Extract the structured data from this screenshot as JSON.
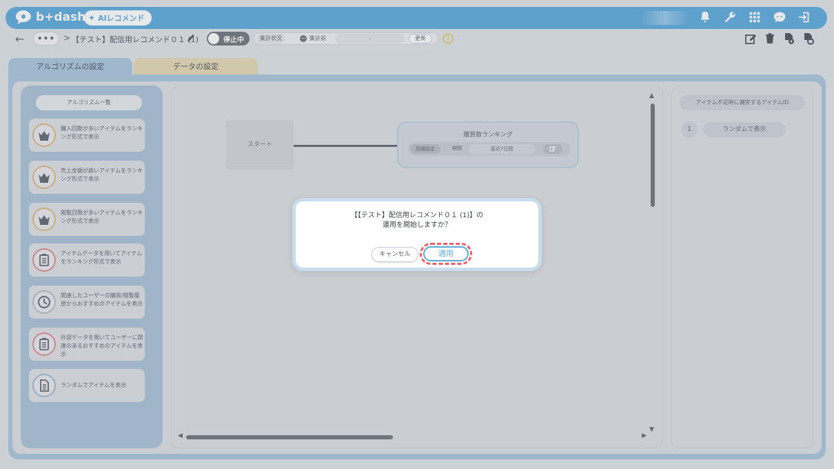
{
  "header": {
    "brand": "b+dash",
    "ai_badge": "AIレコメンド",
    "icons": [
      "bell-icon",
      "wrench-icon",
      "grid-icon",
      "chat-icon",
      "logout-icon"
    ]
  },
  "subbar": {
    "dots": "•••",
    "separator": ">",
    "title": "【テスト】配信用レコメンド０１ (1)",
    "toggle_label": "停止中",
    "status_label": "集計状況",
    "status_icon": "−",
    "status_state": "集計前",
    "status_value": "-",
    "update_label": "更新",
    "tools": [
      "edit-icon",
      "trash-icon",
      "file-gear-icon",
      "file-settings-icon"
    ]
  },
  "tabs": [
    {
      "label": "アルゴリズムの設定",
      "active": true
    },
    {
      "label": "データの設定",
      "active": false
    }
  ],
  "algorithms": {
    "header": "アルゴリズム一覧",
    "items": [
      {
        "label": "購入回数が多いアイテムをランキング形式で表示",
        "icon": "crown-icon",
        "color": "#d9b87a"
      },
      {
        "label": "売上金額が高いアイテムをランキング形式で表示",
        "icon": "crown-icon",
        "color": "#d9b87a"
      },
      {
        "label": "閲覧回数が多いアイテムをランキング形式で表示",
        "icon": "crown-icon",
        "color": "#d9b87a"
      },
      {
        "label": "アイテムデータを用いてアイテムをランキング形式で表示",
        "icon": "clipboard-icon",
        "color": "#d98a8a"
      },
      {
        "label": "関連したユーザーの購買/閲覧履歴からおすすめのアイテムを表示",
        "icon": "clock-icon",
        "color": "#b3bac0"
      },
      {
        "label": "外部データを用いてユーザーに関連のあるおすすめのアイテムを表示",
        "icon": "clipboard-icon",
        "color": "#d98a8a"
      },
      {
        "label": "ランダムでアイテムを表示",
        "icon": "document-icon",
        "color": "#9db8cf"
      }
    ]
  },
  "canvas": {
    "start_node": "スタート",
    "rank_node": {
      "title": "購買数ランキング",
      "detail_label": "詳細設定",
      "period_label": "期間",
      "period_value": "直近7日間"
    }
  },
  "fallback": {
    "header": "アイテム不足時に補完するアイテムID",
    "items": [
      {
        "num": "1",
        "label": "ランダムで表示"
      }
    ]
  },
  "modal": {
    "line1": "【【テスト】配信用レコメンド０１ (1)】の",
    "line2": "運用を開始しますか？",
    "cancel_label": "キャンセル",
    "apply_label": "適用"
  },
  "colors": {
    "accent": "#5aa9dc",
    "highlight": "#e8606a"
  }
}
